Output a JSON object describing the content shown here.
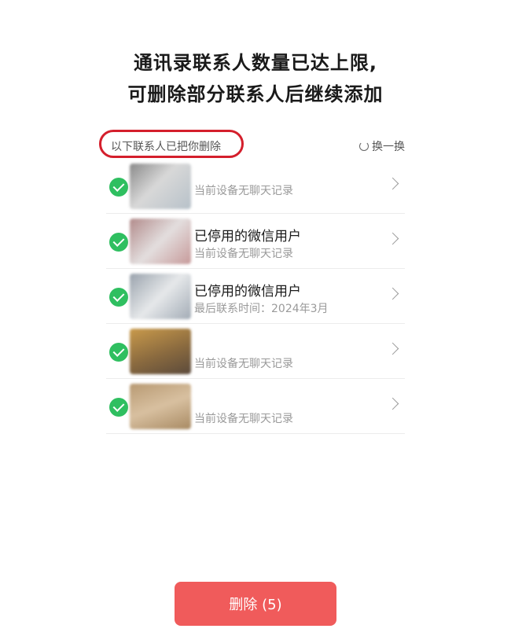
{
  "header": {
    "line1": "通讯录联系人数量已达上限,",
    "line2": "可删除部分联系人后继续添加"
  },
  "list_header": {
    "label": "以下联系人已把你删除",
    "refresh_label": "换一换",
    "highlight_color": "#d41f2c"
  },
  "contacts": [
    {
      "name": "",
      "subtitle": "当前设备无聊天记录",
      "selected": true
    },
    {
      "name": "已停用的微信用户",
      "subtitle": "当前设备无聊天记录",
      "selected": true
    },
    {
      "name": "已停用的微信用户",
      "subtitle": "最后联系时间：2024年3月",
      "selected": true
    },
    {
      "name": "",
      "subtitle": "当前设备无聊天记录",
      "selected": true
    },
    {
      "name": "",
      "subtitle": "当前设备无聊天记录",
      "selected": true
    }
  ],
  "footer": {
    "delete_label": "删除 (5)",
    "accent_color": "#f05b5b"
  },
  "icons": {
    "check": "check-circle-icon",
    "chevron": "chevron-right-icon",
    "refresh": "refresh-icon"
  }
}
